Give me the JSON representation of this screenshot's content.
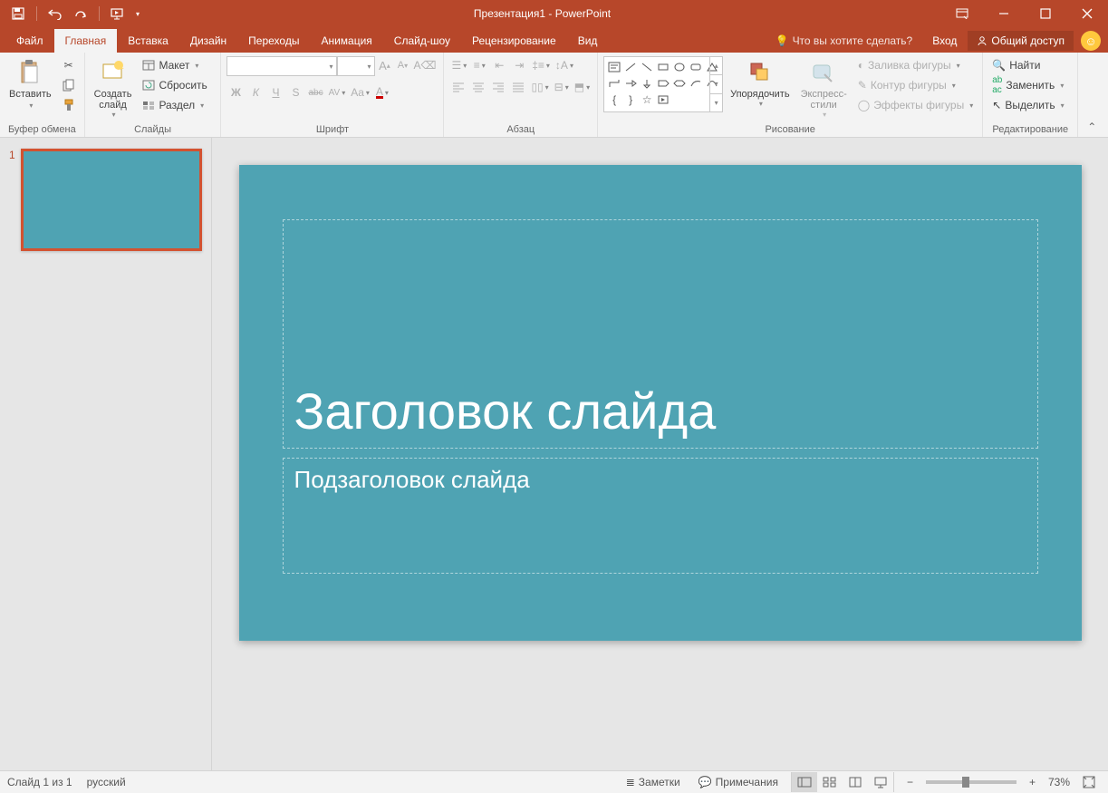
{
  "title": "Презентация1 - PowerPoint",
  "qat": {
    "save": "save",
    "undo": "undo",
    "redo": "redo",
    "start": "start-from-beginning"
  },
  "win": {
    "options": "ribbon-options",
    "min": "minimize",
    "max": "maximize",
    "close": "close"
  },
  "tabs": [
    "Файл",
    "Главная",
    "Вставка",
    "Дизайн",
    "Переходы",
    "Анимация",
    "Слайд-шоу",
    "Рецензирование",
    "Вид"
  ],
  "active_tab": 1,
  "tell_me": "Что вы хотите сделать?",
  "signin": "Вход",
  "share": "Общий доступ",
  "ribbon": {
    "clipboard": {
      "paste": "Вставить",
      "label": "Буфер обмена"
    },
    "slides": {
      "new": "Создать\nслайд",
      "layout": "Макет",
      "reset": "Сбросить",
      "section": "Раздел",
      "label": "Слайды"
    },
    "font": {
      "family_ph": "",
      "size_ph": "",
      "grow": "A",
      "shrink": "A",
      "clear": "Aa",
      "bold": "Ж",
      "italic": "К",
      "underline": "Ч",
      "shadow": "S",
      "strike": "abc",
      "spacing": "AV",
      "case": "Aa",
      "color": "A",
      "label": "Шрифт"
    },
    "paragraph": {
      "label": "Абзац"
    },
    "drawing": {
      "arrange": "Упорядочить",
      "styles": "Экспресс-\nстили",
      "fill": "Заливка фигуры",
      "outline": "Контур фигуры",
      "effects": "Эффекты фигуры",
      "label": "Рисование"
    },
    "editing": {
      "find": "Найти",
      "replace": "Заменить",
      "select": "Выделить",
      "label": "Редактирование"
    }
  },
  "thumb": {
    "num": "1"
  },
  "slide": {
    "title": "Заголовок слайда",
    "subtitle": "Подзаголовок слайда"
  },
  "status": {
    "slide_counter": "Слайд 1 из 1",
    "language": "русский",
    "notes": "Заметки",
    "comments": "Примечания",
    "zoom": "73%"
  }
}
